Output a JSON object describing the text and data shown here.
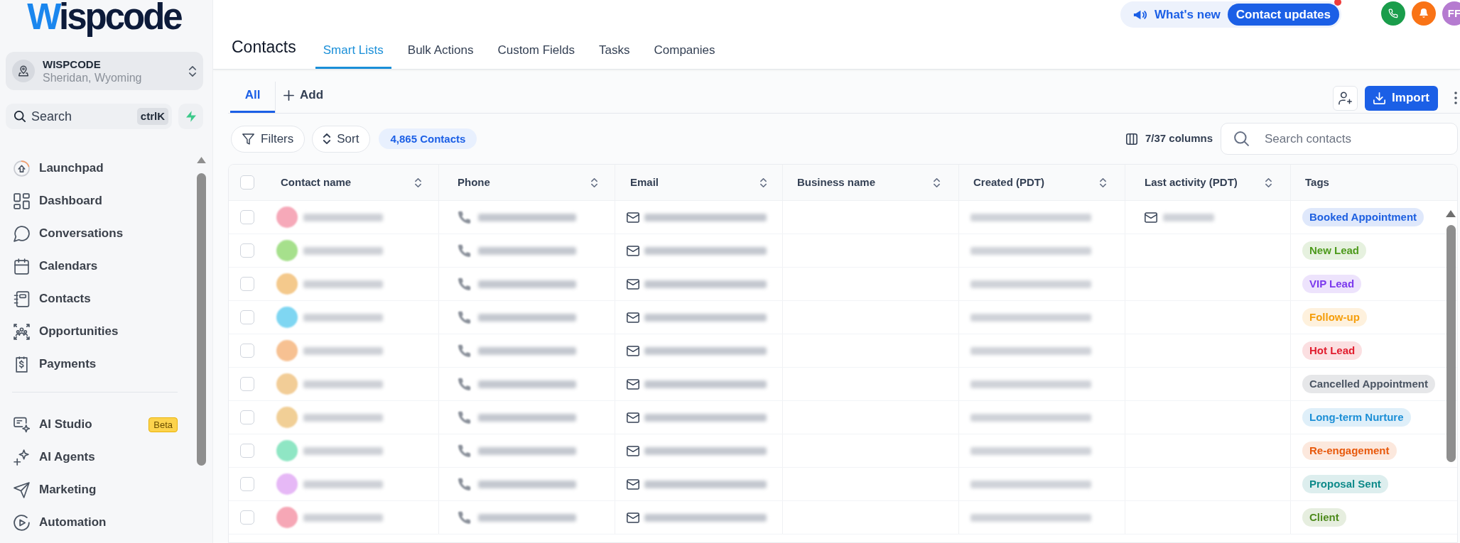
{
  "sidebar": {
    "logo": "Wispcode",
    "account": {
      "name": "WISPCODE",
      "location": "Sheridan, Wyoming"
    },
    "search": {
      "placeholder": "Search",
      "shortcut": "ctrlK"
    },
    "sections": [
      {
        "items": [
          {
            "label": "Launchpad",
            "selected": false
          },
          {
            "label": "Dashboard",
            "selected": false
          },
          {
            "label": "Conversations",
            "selected": false
          },
          {
            "label": "Calendars",
            "selected": false
          },
          {
            "label": "Contacts",
            "selected": false
          },
          {
            "label": "Opportunities",
            "selected": false
          },
          {
            "label": "Payments",
            "selected": false
          }
        ]
      },
      {
        "items": [
          {
            "label": "AI Studio",
            "selected": false,
            "badge": "Beta"
          },
          {
            "label": "AI Agents",
            "selected": false
          },
          {
            "label": "Marketing",
            "selected": false
          },
          {
            "label": "Automation",
            "selected": false
          }
        ]
      }
    ]
  },
  "top_bar": {
    "announcement": {
      "label": "What's new",
      "button": "Contact updates",
      "has_notification": true
    },
    "user_initials": "FF"
  },
  "header": {
    "title": "Contacts",
    "tabs": [
      {
        "label": "Smart Lists",
        "selected": true
      },
      {
        "label": "Bulk Actions",
        "selected": false
      },
      {
        "label": "Custom Fields",
        "selected": false
      },
      {
        "label": "Tasks",
        "selected": false
      },
      {
        "label": "Companies",
        "selected": false
      }
    ]
  },
  "list_bar": {
    "tabs": [
      {
        "label": "All",
        "selected": true
      }
    ],
    "add_label": "Add",
    "import_label": "Import"
  },
  "toolbar": {
    "filters_label": "Filters",
    "sort_label": "Sort",
    "count": "4,865 Contacts",
    "columns_label": "7/37 columns",
    "search": {
      "placeholder": "Search contacts"
    }
  },
  "table": {
    "select_all": {
      "checked": false
    },
    "columns": [
      {
        "label": "Contact name",
        "sortable": true
      },
      {
        "label": "Phone",
        "sortable": true
      },
      {
        "label": "Email",
        "sortable": true
      },
      {
        "label": "Business name",
        "sortable": true
      },
      {
        "label": "Created (PDT)",
        "sortable": true
      },
      {
        "label": "Last activity (PDT)",
        "sortable": true
      },
      {
        "label": "Tags",
        "sortable": false
      }
    ],
    "rows": [
      {
        "checked": false,
        "blurred": true,
        "avatar": {
          "color": "#f6a9b9"
        },
        "last_activity": {
          "kind": "email"
        },
        "tag": {
          "label": "Booked Appointment",
          "color": "#1d5fe0"
        }
      },
      {
        "checked": false,
        "blurred": true,
        "avatar": {
          "color": "#a6e08c"
        },
        "tag": {
          "label": "New Lead",
          "color": "#4d9a1c"
        }
      },
      {
        "checked": false,
        "blurred": true,
        "avatar": {
          "color": "#f4c98c"
        },
        "tag": {
          "label": "VIP Lead",
          "color": "#7c3aed"
        }
      },
      {
        "checked": false,
        "blurred": true,
        "avatar": {
          "color": "#7fd6f2"
        },
        "tag": {
          "label": "Follow-up",
          "color": "#f59e0b"
        }
      },
      {
        "checked": false,
        "blurred": true,
        "avatar": {
          "color": "#f7c192"
        },
        "tag": {
          "label": "Hot Lead",
          "color": "#e11d2e"
        }
      },
      {
        "checked": false,
        "blurred": true,
        "avatar": {
          "color": "#f2cd97"
        },
        "tag": {
          "label": "Cancelled Appointment",
          "color": "#4b5563"
        }
      },
      {
        "checked": false,
        "blurred": true,
        "avatar": {
          "color": "#f1cf96"
        },
        "tag": {
          "label": "Long-term Nurture",
          "color": "#1c8fd6"
        }
      },
      {
        "checked": false,
        "blurred": true,
        "avatar": {
          "color": "#8fe6c4"
        },
        "tag": {
          "label": "Re-engagement",
          "color": "#e8590c"
        }
      },
      {
        "checked": false,
        "blurred": true,
        "avatar": {
          "color": "#e6b8f6"
        },
        "tag": {
          "label": "Proposal Sent",
          "color": "#0e8a8a"
        }
      },
      {
        "checked": false,
        "blurred": true,
        "avatar": {
          "color": "#f6a7b6"
        },
        "tag": {
          "label": "Client",
          "color": "#4d8a1c"
        }
      }
    ]
  }
}
